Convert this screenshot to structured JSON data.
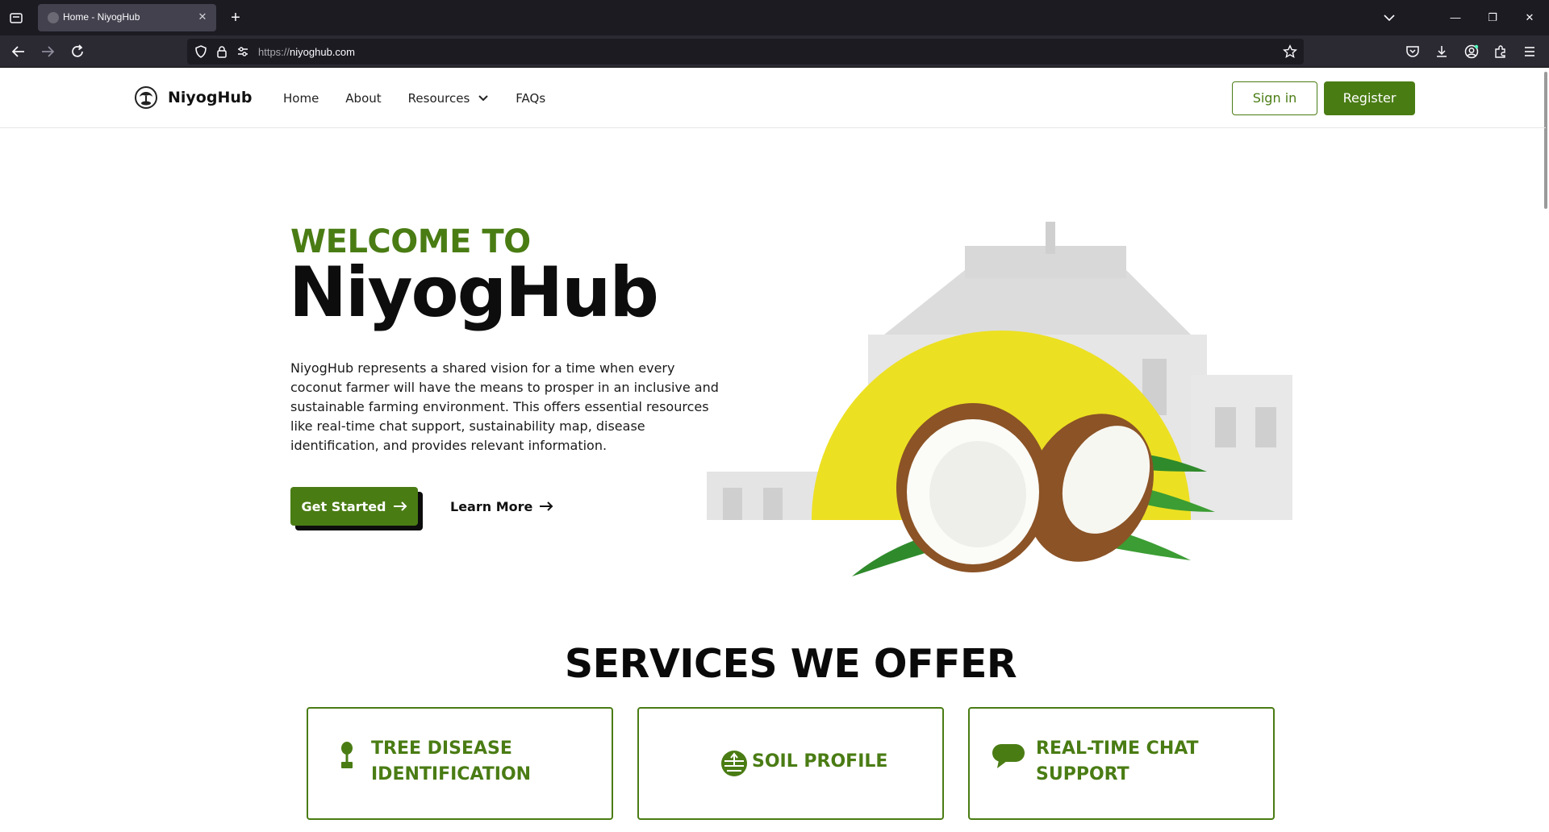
{
  "browser": {
    "tab_title": "Home - NiyogHub",
    "url_protocol": "https://",
    "url_host": "niyoghub.com"
  },
  "nav": {
    "brand": "NiyogHub",
    "items": [
      "Home",
      "About",
      "Resources",
      "FAQs"
    ],
    "signin_label": "Sign in",
    "register_label": "Register"
  },
  "hero": {
    "eyebrow": "WELCOME TO",
    "title": "NiyogHub",
    "description": "NiyogHub represents a shared vision for a time when every coconut farmer will have the means to prosper in an inclusive and sustainable farming environment. This offers essential resources like real-time chat support, sustainability map, disease identification, and provides relevant information.",
    "primary_cta": "Get Started",
    "secondary_cta": "Learn More"
  },
  "services": {
    "title": "SERVICES WE OFFER",
    "cards": [
      {
        "icon": "tree-icon",
        "line1": "TREE DISEASE",
        "line2": "IDENTIFICATION"
      },
      {
        "icon": "soil-icon",
        "line1": "SOIL PROFILE",
        "line2": ""
      },
      {
        "icon": "chat-icon",
        "line1": "REAL-TIME CHAT",
        "line2": "SUPPORT"
      }
    ]
  },
  "colors": {
    "brand_green": "#4a7c14",
    "accent_yellow": "#ece022"
  }
}
